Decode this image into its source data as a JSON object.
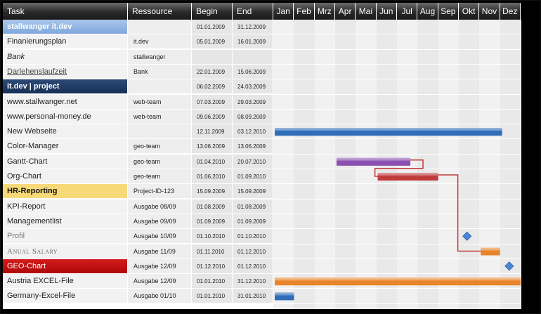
{
  "headers": {
    "task": "Task",
    "resource": "Ressource",
    "begin": "Begin",
    "end": "End"
  },
  "months": [
    "Jan",
    "Feb",
    "Mrz",
    "Apr",
    "Mai",
    "Jun",
    "Jul",
    "Aug",
    "Sep",
    "Okt",
    "Nov",
    "Dez"
  ],
  "rows": [
    {
      "task": "stallwanger  it.dev",
      "resource": "",
      "begin": "01.01.2009",
      "end": "31.12.2009",
      "style": "group-light"
    },
    {
      "task": "Finanierungsplan",
      "resource": "it.dev",
      "begin": "05.01.2009",
      "end": "16.01.2009",
      "style": "normal"
    },
    {
      "task": "Bank",
      "resource": "stallwanger",
      "begin": "",
      "end": "",
      "style": "italic"
    },
    {
      "task": "Darlehenslaufzeit",
      "resource": "Bank",
      "begin": "22.01.2009",
      "end": "15.06.2009",
      "style": "underline"
    },
    {
      "task": "it.dev  |  project",
      "resource": "",
      "begin": "06.02.2009",
      "end": "24.03.2009",
      "style": "group-dark"
    },
    {
      "task": "www.stallwanger.net",
      "resource": "web-team",
      "begin": "07.03.2009",
      "end": "29.03.2009",
      "style": "normal"
    },
    {
      "task": "www.personal-money.de",
      "resource": "web-team",
      "begin": "09.06.2009",
      "end": "08.09.2009",
      "style": "normal"
    },
    {
      "task": "New Webseite",
      "resource": "",
      "begin": "12.11.2009",
      "end": "03.12.2010",
      "style": "normal"
    },
    {
      "task": "Color-Manager",
      "resource": "geo-team",
      "begin": "13.06.2009",
      "end": "13.06.2009",
      "style": "normal"
    },
    {
      "task": "Gantt-Chart",
      "resource": "geo-team",
      "begin": "01.04.2010",
      "end": "20.07.2010",
      "style": "normal"
    },
    {
      "task": "Org-Chart",
      "resource": "geo-team",
      "begin": "01.06.2010",
      "end": "01.09.2010",
      "style": "normal"
    },
    {
      "task": "HR-Reporting",
      "resource": "Project-ID-123",
      "begin": "15.09.2009",
      "end": "15.09.2009",
      "style": "yellow"
    },
    {
      "task": "KPI-Report",
      "resource": "Ausgabe 08/09",
      "begin": "01.08.2009",
      "end": "01.08.2009",
      "style": "normal"
    },
    {
      "task": "Managementlist",
      "resource": "Ausgabe 09/09",
      "begin": "01.09.2009",
      "end": "01.09.2009",
      "style": "normal"
    },
    {
      "task": "Profil",
      "resource": "Ausgabe 10/09",
      "begin": "01.10.2010",
      "end": "01.10.2010",
      "style": "gray"
    },
    {
      "task": "Anual Salary",
      "resource": "Ausgabe 11/09",
      "begin": "01.11.2010",
      "end": "01.12.2010",
      "style": "smallcaps"
    },
    {
      "task": "GEO-Chart",
      "resource": "Ausgabe 12/09",
      "begin": "01.12.2010",
      "end": "01.12.2010",
      "style": "red"
    },
    {
      "task": "Austria  EXCEL-File",
      "resource": "Ausgabe 12/09",
      "begin": "01.01.2010",
      "end": "31.12.2010",
      "style": "normal"
    },
    {
      "task": "Germany-Excel-File",
      "resource": "Ausgabe 01/10",
      "begin": "01.01.2010",
      "end": "31.01.2010",
      "style": "normal"
    }
  ],
  "chart_data": {
    "type": "gantt",
    "year": 2010,
    "bars": [
      {
        "row": 7,
        "task": "New Webseite",
        "start_month": 0,
        "end_month": 11.1,
        "color": "#2f6db8"
      },
      {
        "row": 9,
        "task": "Gantt-Chart",
        "start_month": 3.0,
        "end_month": 6.65,
        "color": "#8a4fb0"
      },
      {
        "row": 10,
        "task": "Org-Chart",
        "start_month": 5.0,
        "end_month": 8.0,
        "color": "#c03a3a"
      },
      {
        "row": 15,
        "task": "Anual Salary",
        "start_month": 10.0,
        "end_month": 11.0,
        "color": "#e8842a"
      },
      {
        "row": 17,
        "task": "Austria  EXCEL-File",
        "start_month": 0,
        "end_month": 12.0,
        "color": "#e8842a"
      },
      {
        "row": 18,
        "task": "Germany-Excel-File",
        "start_month": 0,
        "end_month": 1.0,
        "color": "#2f6db8"
      }
    ],
    "milestones": [
      {
        "row": 14,
        "task": "Profil",
        "month": 9.4,
        "color": "#4a86d8"
      },
      {
        "row": 16,
        "task": "GEO-Chart",
        "month": 11.45,
        "color": "#4a86d8"
      }
    ],
    "dependencies": [
      {
        "from_row": 9,
        "to_row": 10
      },
      {
        "from_row": 10,
        "to_row": 15
      }
    ]
  }
}
